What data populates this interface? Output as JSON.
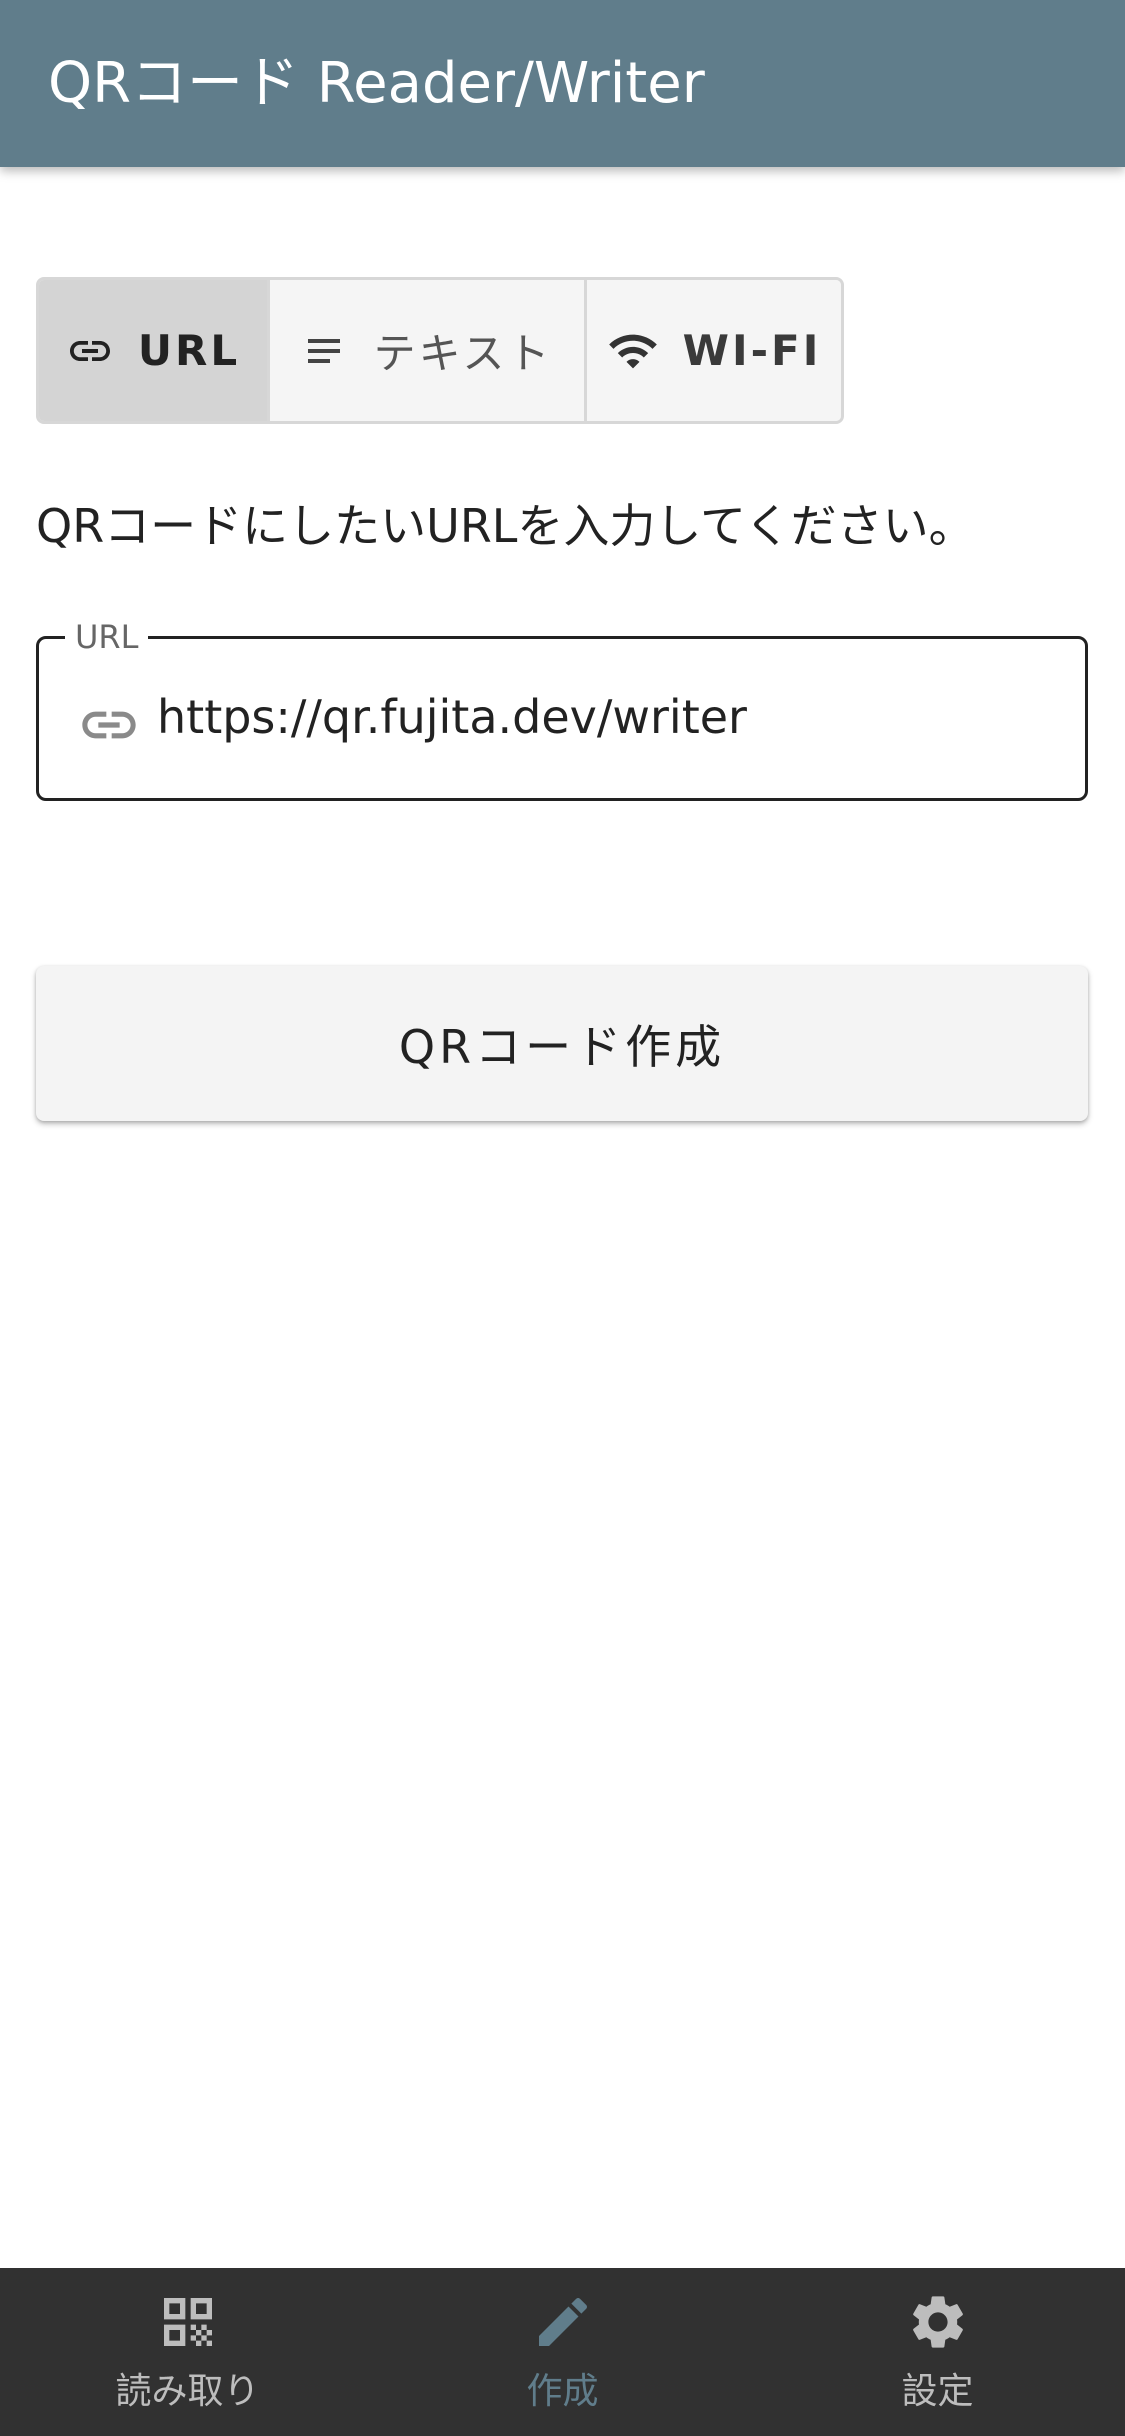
{
  "appbar": {
    "title": "QRコード Reader/Writer"
  },
  "mode_toggle": {
    "items": [
      {
        "label": "URL",
        "icon": "link-icon",
        "selected": true
      },
      {
        "label": "テキスト",
        "icon": "text-lines-icon",
        "selected": false
      },
      {
        "label": "WI-FI",
        "icon": "wifi-icon",
        "selected": false
      }
    ]
  },
  "instruction": "QRコードにしたいURLを入力してください。",
  "url_field": {
    "label": "URL",
    "value": "https://qr.fujita.dev/writer",
    "icon": "link-icon"
  },
  "create_button": {
    "label": "QRコード作成"
  },
  "bottom_nav": {
    "items": [
      {
        "label": "読み取り",
        "icon": "qr-code-scan-icon",
        "active": false
      },
      {
        "label": "作成",
        "icon": "pencil-icon",
        "active": true
      },
      {
        "label": "設定",
        "icon": "gear-icon",
        "active": false
      }
    ]
  },
  "colors": {
    "appbar": "#607d8b",
    "active_nav": "#607d8b",
    "bottom_nav_bg": "#313131",
    "toggle_selected_bg": "#d4d4d4"
  }
}
